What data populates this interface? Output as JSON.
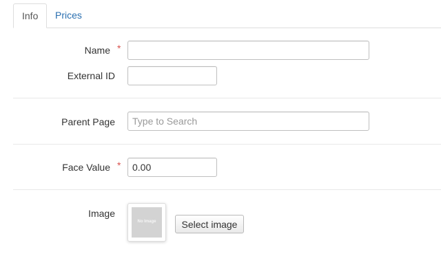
{
  "tabs": [
    {
      "label": "Info",
      "active": true
    },
    {
      "label": "Prices",
      "active": false
    }
  ],
  "form": {
    "name": {
      "label": "Name",
      "required_mark": "*",
      "value": "",
      "placeholder": ""
    },
    "external_id": {
      "label": "External ID",
      "value": "",
      "placeholder": ""
    },
    "parent_page": {
      "label": "Parent Page",
      "value": "",
      "placeholder": "Type to Search"
    },
    "face_value": {
      "label": "Face Value",
      "required_mark": "*",
      "value": "0.00"
    },
    "image": {
      "label": "Image",
      "thumbnail_text": "No Image",
      "select_button": "Select image"
    }
  },
  "colors": {
    "link": "#2a6fb0",
    "required": "#d9534f",
    "border": "#dddddd",
    "placeholder_image": "#d3d3d3"
  }
}
